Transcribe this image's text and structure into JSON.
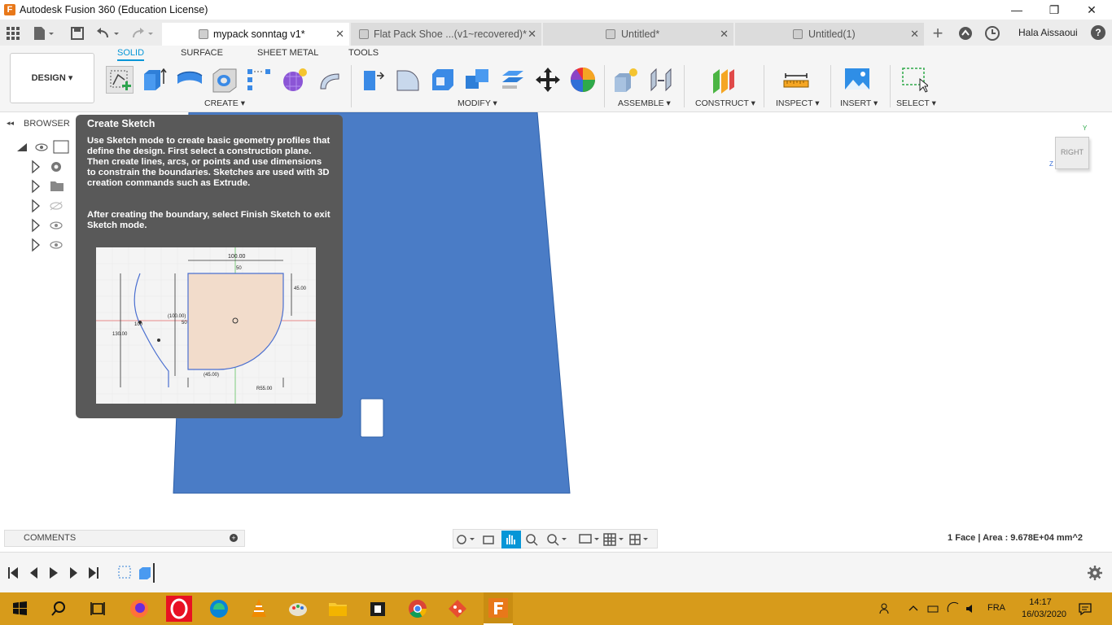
{
  "window": {
    "title": "Autodesk Fusion 360 (Education License)",
    "app_logo_letter": "F",
    "minimize": "—",
    "maximize": "❐",
    "close": "✕"
  },
  "tabs": [
    {
      "label": "mypack sonntag v1*",
      "active": true
    },
    {
      "label": "Flat Pack Shoe ...(v1~recovered)*",
      "active": false
    },
    {
      "label": "Untitled*",
      "active": false
    },
    {
      "label": "Untitled(1)",
      "active": false
    }
  ],
  "tab_close_glyph": "✕",
  "user": {
    "name": "Hala Aissaoui",
    "help": "?"
  },
  "design_menu": {
    "label": "DESIGN ▾"
  },
  "workspace_tabs": [
    "SOLID",
    "SURFACE",
    "SHEET METAL",
    "TOOLS"
  ],
  "tool_groups": [
    {
      "label": "CREATE ▾",
      "icons": [
        "create-sketch-icon",
        "extrude-icon",
        "revolve-icon",
        "hole-icon",
        "pattern-icon",
        "form-icon",
        "sweep-icon"
      ]
    },
    {
      "label": "MODIFY ▾",
      "icons": [
        "press-pull-icon",
        "fillet-icon",
        "shell-icon",
        "combine-icon",
        "offset-face-icon",
        "move-icon",
        "appearance-icon"
      ]
    },
    {
      "label": "ASSEMBLE ▾",
      "icons": [
        "new-component-icon",
        "joint-icon"
      ]
    },
    {
      "label": "CONSTRUCT ▾",
      "icons": [
        "offset-plane-icon"
      ]
    },
    {
      "label": "INSPECT ▾",
      "icons": [
        "measure-icon"
      ]
    },
    {
      "label": "INSERT ▾",
      "icons": [
        "insert-image-icon"
      ]
    },
    {
      "label": "SELECT ▾",
      "icons": [
        "window-select-icon"
      ]
    }
  ],
  "browser": {
    "label": "BROWSER",
    "collapse": "◂◂"
  },
  "viewcube": {
    "face": "RIGHT",
    "axis_y": "Y",
    "axis_z": "Z"
  },
  "tooltip": {
    "title": "Create Sketch",
    "paragraph1": "Use Sketch mode to create basic geometry profiles that define the design. First select a construction plane. Then create lines, arcs, or points and use dimensions to constrain the boundaries. Sketches are used with 3D creation commands such as Extrude.",
    "paragraph2": "After creating the boundary, select Finish Sketch to exit Sketch mode.",
    "image_dims": [
      "100.00",
      "50",
      "45.00",
      "(100.00)",
      "50",
      "130.00",
      "100",
      "(45.00)",
      "R55.00"
    ]
  },
  "comments": {
    "label": "COMMENTS"
  },
  "status": {
    "text": "1 Face | Area : 9.678E+04 mm^2"
  },
  "taskbar": {
    "lang": "FRA",
    "time": "14:17",
    "date": "16/03/2020"
  },
  "colors": {
    "accent": "#0696d7",
    "face_blue": "#4a7cc6",
    "tooltip_bg": "#595959",
    "taskbar": "#d79b1b",
    "fusion_orange": "#e8781a"
  }
}
